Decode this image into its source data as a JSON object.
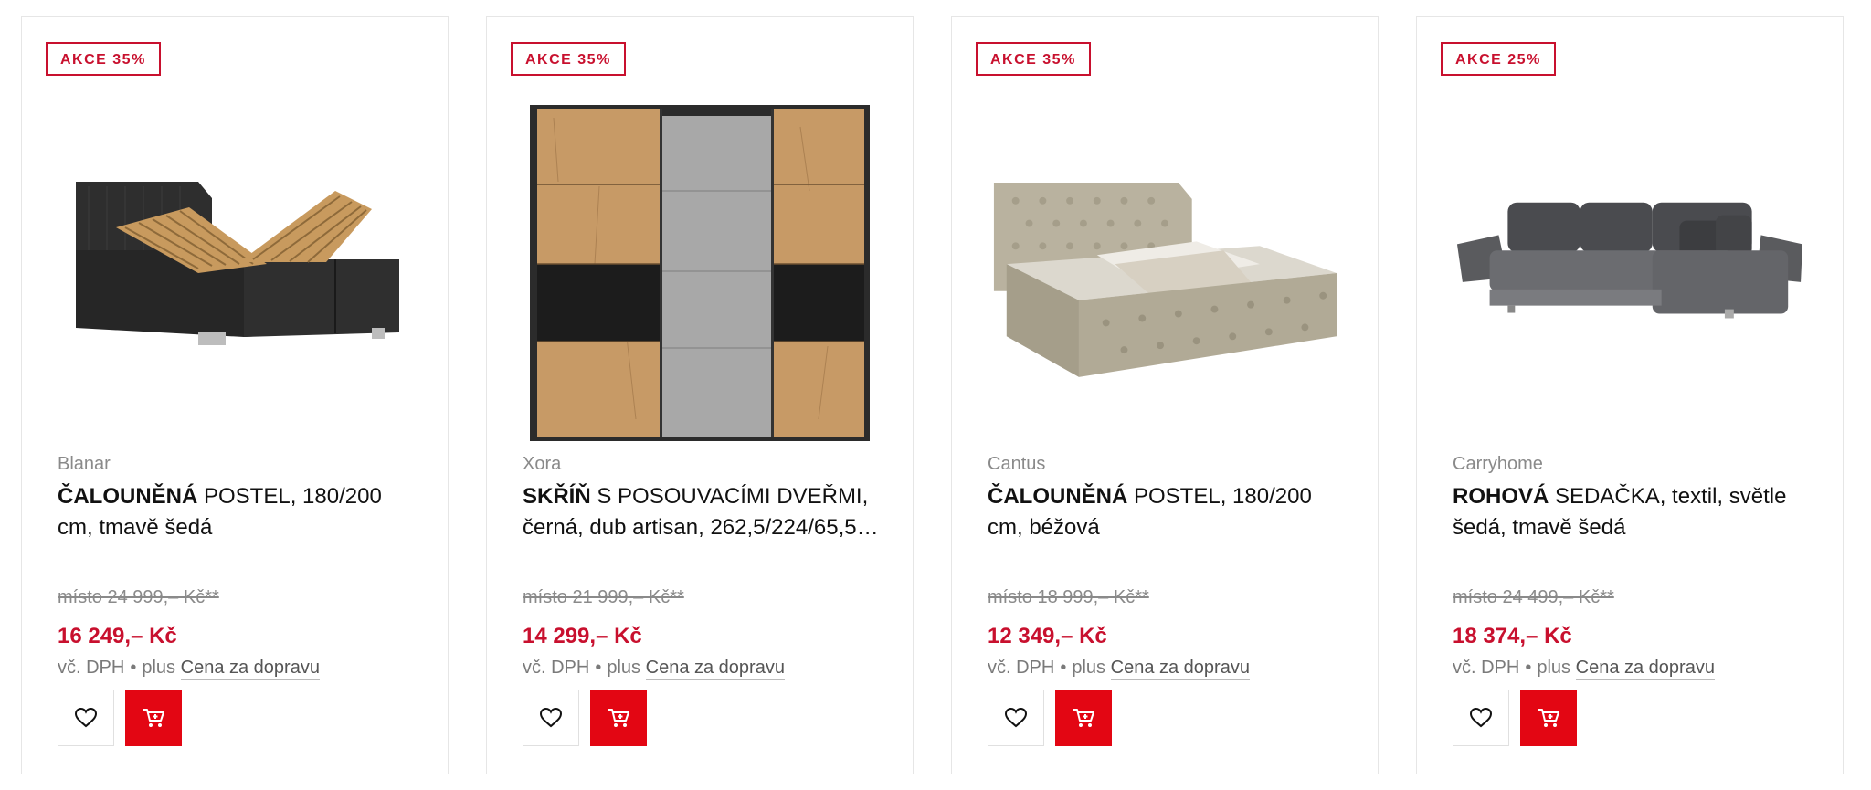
{
  "colors": {
    "accent": "#c8102e",
    "cart_button": "#e30613",
    "muted": "#8a8a8a"
  },
  "products": [
    {
      "badge": "AKCE 35%",
      "brand": "Blanar",
      "title_bold": "ČALOUNĚNÁ",
      "title_rest": " POSTEL, 180/200 cm, tmavě šedá",
      "old_price": "místo 24 999,– Kč**",
      "price": "16 249,– Kč",
      "tax_label": "vč. DPH",
      "dot": "•",
      "plus_label": "plus",
      "shipping_link": "Cena za dopravu",
      "image_icon": "upholstered-bed-dark-grey-image",
      "wishlist_icon": "heart-icon",
      "cart_icon": "cart-icon"
    },
    {
      "badge": "AKCE 35%",
      "brand": "Xora",
      "title_bold": "SKŘÍŇ",
      "title_rest": " S POSOUVACÍMI DVEŘMI, černá, dub artisan, 262,5/224/65,5…",
      "old_price": "místo 21 999,– Kč**",
      "price": "14 299,– Kč",
      "tax_label": "vč. DPH",
      "dot": "•",
      "plus_label": "plus",
      "shipping_link": "Cena za dopravu",
      "image_icon": "sliding-wardrobe-image",
      "wishlist_icon": "heart-icon",
      "cart_icon": "cart-icon"
    },
    {
      "badge": "AKCE 35%",
      "brand": "Cantus",
      "title_bold": "ČALOUNĚNÁ",
      "title_rest": " POSTEL, 180/200 cm, béžová",
      "old_price": "místo 18 999,– Kč**",
      "price": "12 349,– Kč",
      "tax_label": "vč. DPH",
      "dot": "•",
      "plus_label": "plus",
      "shipping_link": "Cena za dopravu",
      "image_icon": "upholstered-bed-beige-image",
      "wishlist_icon": "heart-icon",
      "cart_icon": "cart-icon"
    },
    {
      "badge": "AKCE 25%",
      "brand": "Carryhome",
      "title_bold": "ROHOVÁ",
      "title_rest": " SEDAČKA, textil, světle šedá, tmavě šedá",
      "old_price": "místo 24 499,– Kč**",
      "price": "18 374,– Kč",
      "tax_label": "vč. DPH",
      "dot": "•",
      "plus_label": "plus",
      "shipping_link": "Cena za dopravu",
      "image_icon": "corner-sofa-image",
      "wishlist_icon": "heart-icon",
      "cart_icon": "cart-icon"
    }
  ]
}
